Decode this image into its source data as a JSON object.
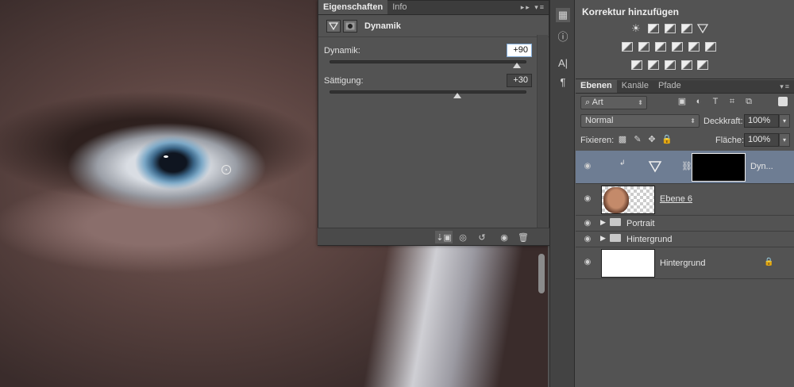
{
  "properties": {
    "tabs": [
      "Eigenschaften",
      "Info"
    ],
    "panel_title": "Dynamik",
    "sliders": [
      {
        "label": "Dynamik:",
        "value": "+90",
        "level": 0.95
      },
      {
        "label": "Sättigung:",
        "value": "+30",
        "level": 0.65
      }
    ]
  },
  "adjustments": {
    "title": "Korrektur hinzufügen"
  },
  "layers": {
    "tabs": [
      "Ebenen",
      "Kanäle",
      "Pfade"
    ],
    "filter": "Art",
    "blend_mode": "Normal",
    "opacity_label": "Deckkraft:",
    "opacity": "100%",
    "lock_label": "Fixieren:",
    "fill_label": "Fläche:",
    "fill": "100%",
    "rows": [
      {
        "name": "Dyn...",
        "selected": true
      },
      {
        "name": "Ebene 6"
      },
      {
        "name": "Portrait",
        "type": "group"
      },
      {
        "name": "Hintergrund",
        "type": "group"
      },
      {
        "name": "Hintergrund",
        "locked": true
      }
    ]
  },
  "colors": {
    "panel": "#535353",
    "selection": "#6e7d93"
  }
}
